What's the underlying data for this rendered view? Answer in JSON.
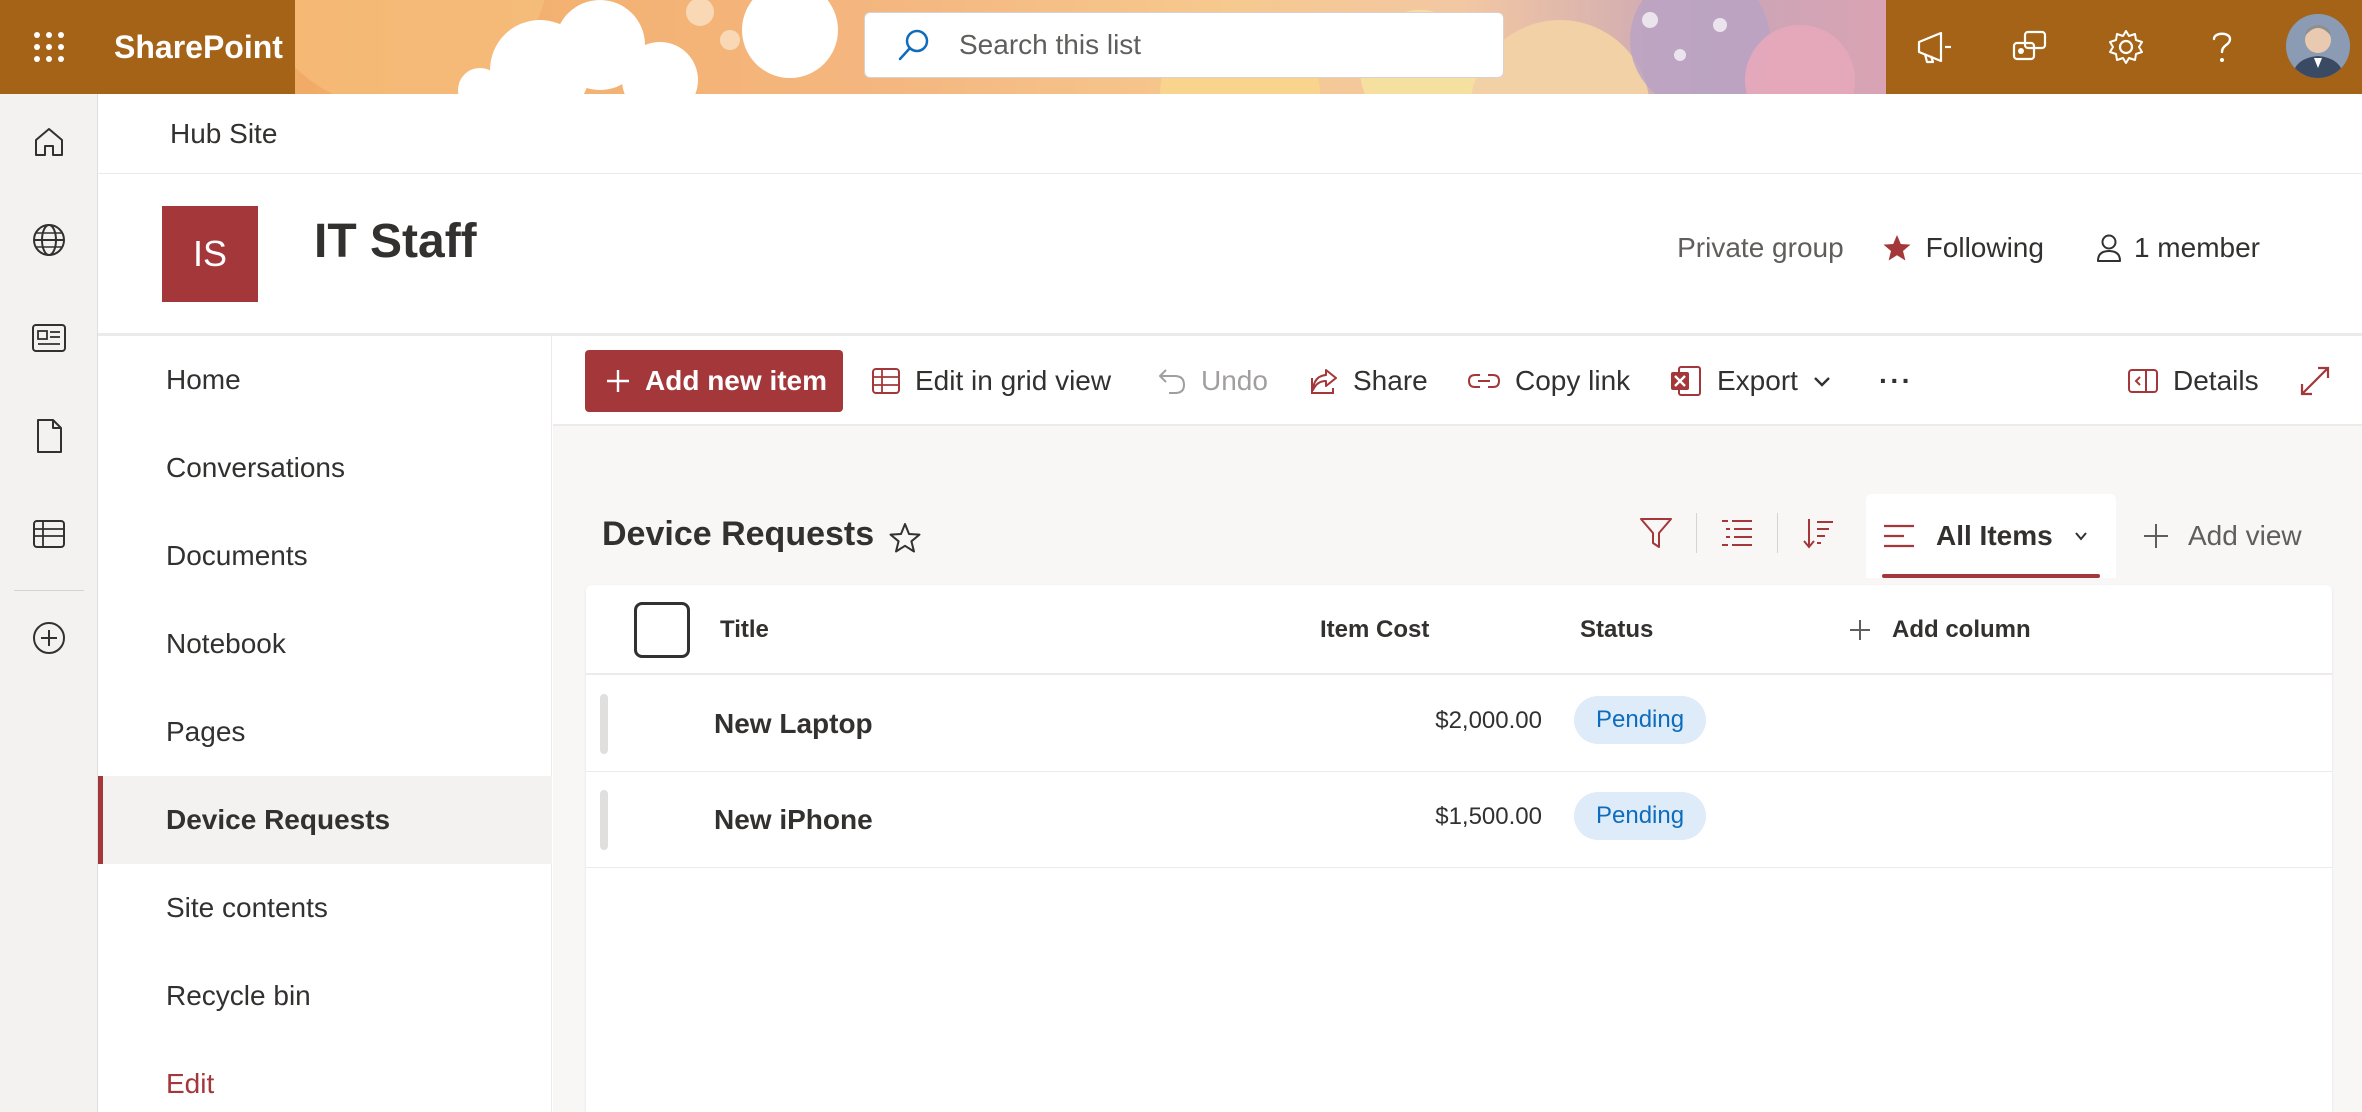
{
  "suite": {
    "brand": "SharePoint",
    "search_placeholder": "Search this list"
  },
  "appbar": {
    "items": [
      "home",
      "sites",
      "news",
      "files",
      "lists",
      "create"
    ]
  },
  "hub": {
    "label": "Hub Site"
  },
  "site": {
    "logo_text": "IS",
    "title": "IT Staff",
    "privacy": "Private group",
    "follow_label": "Following",
    "members_label": "1 member"
  },
  "leftnav": {
    "items": [
      {
        "label": "Home"
      },
      {
        "label": "Conversations"
      },
      {
        "label": "Documents"
      },
      {
        "label": "Notebook"
      },
      {
        "label": "Pages"
      },
      {
        "label": "Device Requests"
      },
      {
        "label": "Site contents"
      },
      {
        "label": "Recycle bin"
      },
      {
        "label": "Edit"
      }
    ],
    "active": "Device Requests"
  },
  "commandbar": {
    "add_new": "Add new item",
    "edit_grid": "Edit in grid view",
    "undo": "Undo",
    "share": "Share",
    "copy_link": "Copy link",
    "export": "Export",
    "more": "···",
    "details": "Details"
  },
  "list": {
    "title": "Device Requests",
    "view_name": "All Items",
    "add_view": "Add view",
    "columns": {
      "title": "Title",
      "item_cost": "Item Cost",
      "status": "Status",
      "add_column": "Add column"
    },
    "rows": [
      {
        "title": "New Laptop",
        "item_cost": "$2,000.00",
        "status": "Pending"
      },
      {
        "title": "New iPhone",
        "item_cost": "$1,500.00",
        "status": "Pending"
      }
    ]
  },
  "colors": {
    "accent": "#a4373a",
    "suitebar": "#a46316",
    "status_pill_bg": "#deecf9",
    "status_pill_text": "#0f6cbd"
  }
}
